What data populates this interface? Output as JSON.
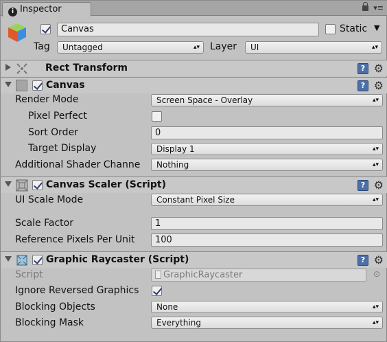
{
  "tab": {
    "title": "Inspector"
  },
  "object": {
    "name": "Canvas",
    "static_label": "Static",
    "tag_label": "Tag",
    "tag_value": "Untagged",
    "layer_label": "Layer",
    "layer_value": "UI"
  },
  "rect_transform": {
    "title": "Rect Transform"
  },
  "canvas": {
    "title": "Canvas",
    "render_mode_label": "Render Mode",
    "render_mode_value": "Screen Space - Overlay",
    "pixel_perfect_label": "Pixel Perfect",
    "sort_order_label": "Sort Order",
    "sort_order_value": "0",
    "target_display_label": "Target Display",
    "target_display_value": "Display 1",
    "shader_label": "Additional Shader Channe",
    "shader_value": "Nothing"
  },
  "scaler": {
    "title": "Canvas Scaler (Script)",
    "ui_scale_label": "UI Scale Mode",
    "ui_scale_value": "Constant Pixel Size",
    "scale_factor_label": "Scale Factor",
    "scale_factor_value": "1",
    "ref_ppu_label": "Reference Pixels Per Unit",
    "ref_ppu_value": "100"
  },
  "raycaster": {
    "title": "Graphic Raycaster (Script)",
    "script_label": "Script",
    "script_value": "GraphicRaycaster",
    "ignore_label": "Ignore Reversed Graphics",
    "blocking_objects_label": "Blocking Objects",
    "blocking_objects_value": "None",
    "blocking_mask_label": "Blocking Mask",
    "blocking_mask_value": "Everything"
  },
  "help_glyph": "?",
  "colors": {
    "background": "#c2c2c2",
    "header": "#c8c8c8",
    "help": "#4c6fa8"
  }
}
